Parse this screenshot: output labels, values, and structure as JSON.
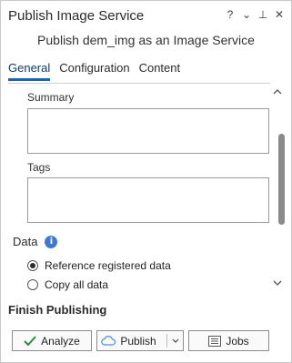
{
  "window": {
    "title": "Publish Image Service",
    "controls": {
      "help": "?",
      "menu": "⌄",
      "pin": "⊥",
      "close": "✕"
    }
  },
  "subtitle": "Publish dem_img as an Image Service",
  "tabs": [
    {
      "label": "General",
      "active": true
    },
    {
      "label": "Configuration",
      "active": false
    },
    {
      "label": "Content",
      "active": false
    }
  ],
  "fields": {
    "summary": {
      "label": "Summary",
      "value": ""
    },
    "tags": {
      "label": "Tags",
      "value": ""
    }
  },
  "data_section": {
    "title": "Data",
    "info_icon_glyph": "i",
    "options": [
      {
        "label": "Reference registered data",
        "checked": true
      },
      {
        "label": "Copy all data",
        "checked": false
      }
    ]
  },
  "finish": {
    "title": "Finish Publishing",
    "analyze_label": "Analyze",
    "publish_label": "Publish",
    "jobs_label": "Jobs"
  },
  "colors": {
    "accent": "#1a66b3",
    "info": "#3d7ad8",
    "check_green": "#2e8b3a"
  },
  "icons": [
    "chevron-up-icon",
    "chevron-down-icon",
    "info-icon",
    "checkmark-icon",
    "cloud-icon",
    "dropdown-arrow-icon",
    "jobs-icon"
  ]
}
